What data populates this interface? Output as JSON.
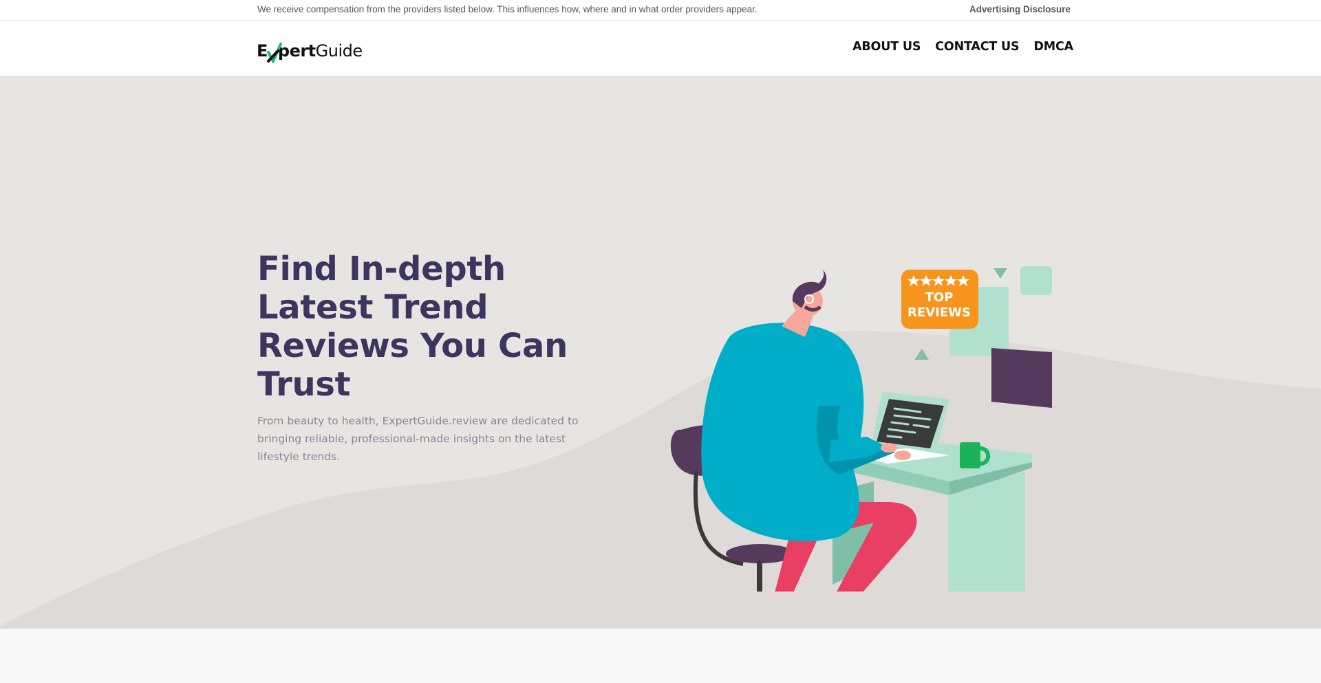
{
  "topbar": {
    "disclaimer": "We receive compensation from the providers listed below. This influences how, where and in what order providers appear.",
    "advertising_link": "Advertising Disclosure"
  },
  "header": {
    "logo": {
      "part_bold_prefix": "E",
      "part_bold_suffix": "pert",
      "part_regular": "Guide"
    },
    "nav": [
      "ABOUT US",
      "CONTACT US",
      "DMCA"
    ]
  },
  "hero": {
    "title": "Find In-depth Latest Trend Reviews You Can Trust",
    "subtitle": "From beauty to health, ExpertGuide.review are dedicated to bringing reliable, professional-made insights on the latest lifestyle trends.",
    "badge": {
      "line1": "TOP",
      "line2": "REVIEWS",
      "stars": 5
    }
  },
  "colors": {
    "heading": "#3c3560",
    "hero_bg": "#e7e5e2",
    "wave": "#dedad7",
    "accent_green": "#1fb88a",
    "badge_orange": "#f7941d",
    "shirt_blue": "#00aec9",
    "pants_red": "#e83f63",
    "desk_mint": "#b1e0cf",
    "chair_purple": "#563a5e"
  },
  "icons": [
    "logo-check-icon",
    "star-icon"
  ]
}
